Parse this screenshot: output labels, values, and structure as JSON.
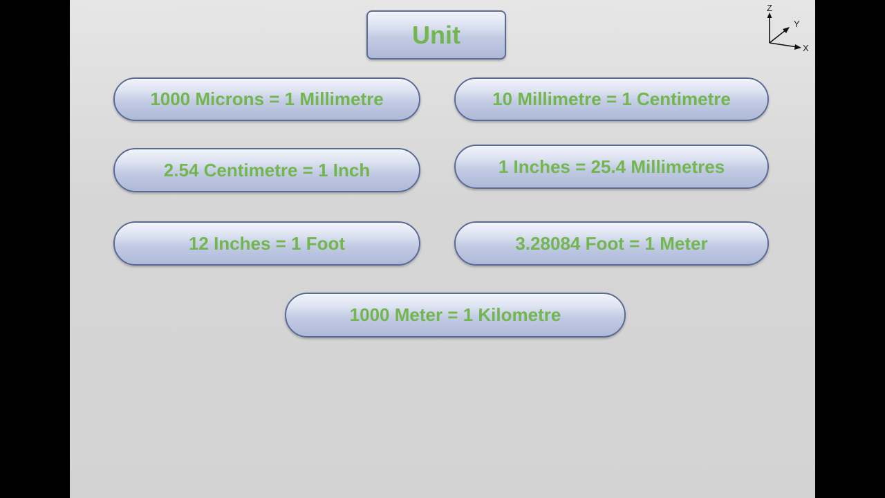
{
  "title": "Unit",
  "axes_icon": {
    "name": "xyz-axes-icon",
    "labels": {
      "z": "Z",
      "y": "Y",
      "x": "X"
    }
  },
  "conversions": [
    "1000 Microns = 1 Millimetre",
    "10 Millimetre = 1 Centimetre",
    "2.54 Centimetre = 1 Inch",
    "1 Inches = 25.4 Millimetres",
    "12 Inches = 1 Foot",
    "3.28084 Foot = 1 Meter",
    "1000 Meter = 1 Kilometre"
  ],
  "colors": {
    "text_green": "#73b54f",
    "border_blue": "#5a6a94",
    "background_gray": "#d6d6d6"
  }
}
